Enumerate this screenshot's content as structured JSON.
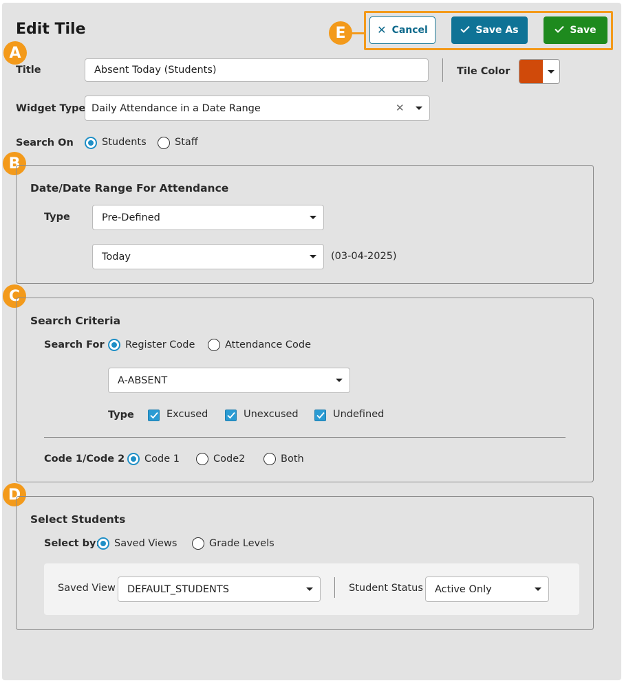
{
  "page": {
    "title": "Edit Tile"
  },
  "badges": {
    "a": "A",
    "b": "B",
    "c": "C",
    "d": "D",
    "e": "E"
  },
  "toolbar": {
    "cancel_label": "Cancel",
    "save_as_label": "Save As",
    "save_label": "Save"
  },
  "general": {
    "title_label": "Title",
    "title_value": "Absent Today (Students)",
    "tile_color_label": "Tile Color",
    "tile_color": "#d04a0a",
    "widget_type_label": "Widget Type",
    "widget_type_value": "Daily Attendance in a Date Range",
    "search_on_label": "Search On",
    "search_on_options": [
      "Students",
      "Staff"
    ],
    "search_on_selected": "Students"
  },
  "date_section": {
    "heading": "Date/Date Range For Attendance",
    "type_label": "Type",
    "type_value": "Pre-Defined",
    "range_value": "Today",
    "range_date": "(03-04-2025)"
  },
  "criteria_section": {
    "heading": "Search Criteria",
    "search_for_label": "Search For",
    "search_for_options": [
      "Register Code",
      "Attendance Code"
    ],
    "search_for_selected": "Register Code",
    "code_value": "A-ABSENT",
    "type_label": "Type",
    "type_checks": [
      {
        "label": "Excused",
        "checked": true
      },
      {
        "label": "Unexcused",
        "checked": true
      },
      {
        "label": "Undefined",
        "checked": true
      }
    ],
    "code_label": "Code 1/Code 2",
    "code_options": [
      "Code 1",
      "Code2",
      "Both"
    ],
    "code_selected": "Code 1"
  },
  "students_section": {
    "heading": "Select Students",
    "select_by_label": "Select by:",
    "select_by_options": [
      "Saved Views",
      "Grade Levels"
    ],
    "select_by_selected": "Saved Views",
    "saved_view_label": "Saved View",
    "saved_view_value": "DEFAULT_STUDENTS",
    "student_status_label": "Student Status",
    "student_status_value": "Active Only"
  },
  "colors": {
    "accent_orange": "#f39a1b",
    "save_green": "#1e8a1e",
    "save_as_blue": "#0f7396",
    "radio_blue": "#1f8fc6"
  }
}
